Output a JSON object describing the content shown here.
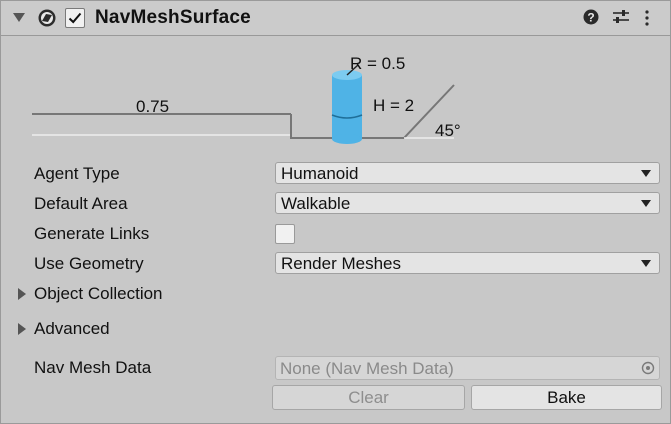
{
  "component": {
    "title": "NavMeshSurface",
    "enabled": true,
    "icons": [
      "navmesh-icon",
      "help-icon",
      "presets-icon",
      "menu-icon"
    ]
  },
  "diagram": {
    "step_height_label": "0.75",
    "radius_label": "R = 0.5",
    "height_label": "H = 2",
    "slope_label": "45°",
    "agent_color": "#4fb3e6"
  },
  "properties": {
    "agent_type": {
      "label": "Agent Type",
      "value": "Humanoid"
    },
    "default_area": {
      "label": "Default Area",
      "value": "Walkable"
    },
    "generate_links": {
      "label": "Generate Links",
      "checked": false
    },
    "use_geometry": {
      "label": "Use Geometry",
      "value": "Render Meshes"
    },
    "object_collection": {
      "label": "Object Collection",
      "expanded": false
    },
    "advanced": {
      "label": "Advanced",
      "expanded": false
    },
    "nav_mesh_data": {
      "label": "Nav Mesh Data",
      "value": "None (Nav Mesh Data)"
    }
  },
  "buttons": {
    "clear": "Clear",
    "bake": "Bake"
  }
}
